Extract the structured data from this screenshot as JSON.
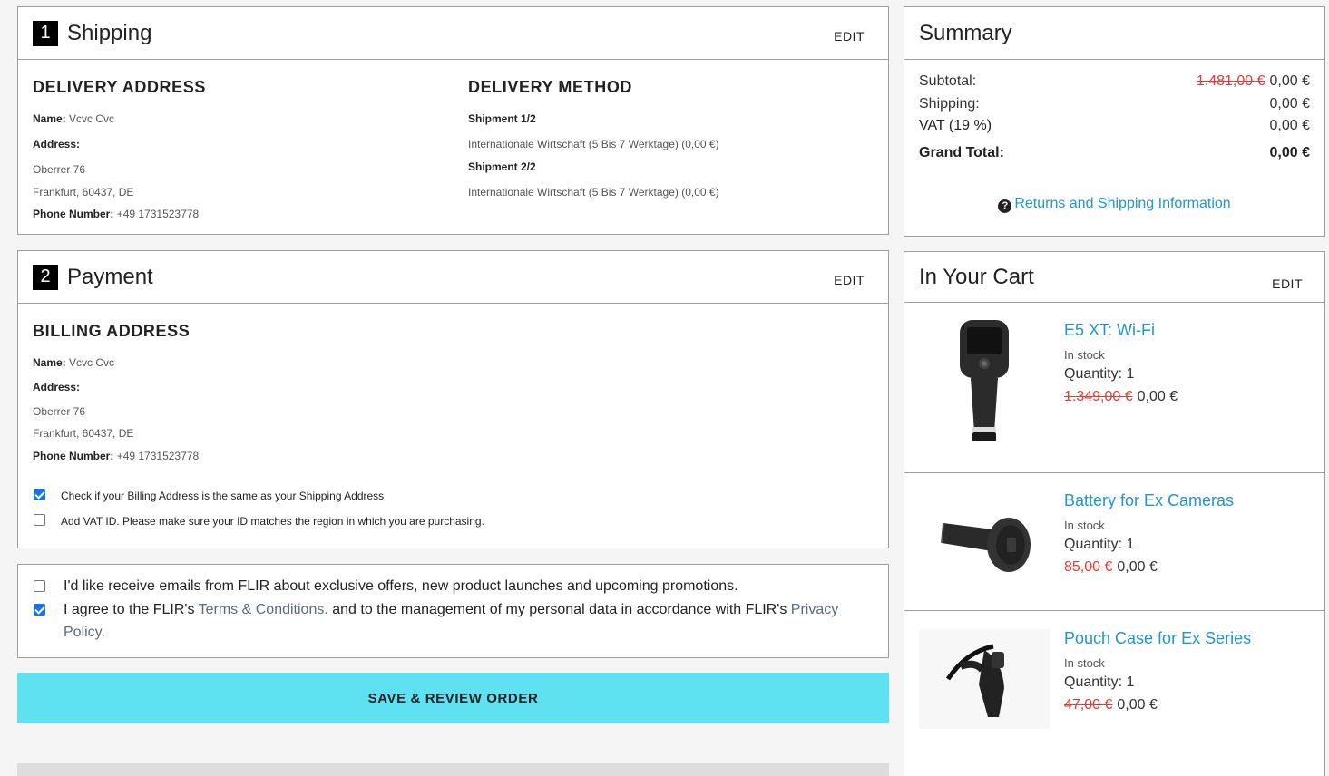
{
  "shipping": {
    "step": "1",
    "title": "Shipping",
    "edit": "EDIT",
    "delivery_address": {
      "heading": "DELIVERY ADDRESS",
      "name_label": "Name:",
      "name": "Vcvc Cvc",
      "address_label": "Address:",
      "street": "Oberrer 76",
      "city": "Frankfurt, 60437, DE",
      "phone_label": "Phone Number:",
      "phone": "+49 1731523778"
    },
    "delivery_method": {
      "heading": "DELIVERY METHOD",
      "shipments": [
        {
          "label": "Shipment 1/2",
          "method": "Internationale Wirtschaft (5 Bis 7 Werktage) (0,00 €)"
        },
        {
          "label": "Shipment 2/2",
          "method": "Internationale Wirtschaft (5 Bis 7 Werktage) (0,00 €)"
        }
      ]
    }
  },
  "payment": {
    "step": "2",
    "title": "Payment",
    "edit": "EDIT",
    "billing": {
      "heading": "BILLING ADDRESS",
      "name_label": "Name:",
      "name": "Vcvc Cvc",
      "address_label": "Address:",
      "street": "Oberrer 76",
      "city": "Frankfurt, 60437, DE",
      "phone_label": "Phone Number:",
      "phone": "+49 1731523778"
    },
    "same_as_shipping": {
      "label": "Check if your Billing Address is the same as your Shipping Address",
      "checked": true
    },
    "vat_id": {
      "label": "Add VAT ID. Please make sure your ID matches the region in which you are purchasing.",
      "checked": false
    }
  },
  "consent": {
    "emails": {
      "label": "I'd like receive emails from FLIR about exclusive offers, new product launches and upcoming promotions.",
      "checked": false
    },
    "terms": {
      "checked": true,
      "prefix": "I agree to the FLIR's ",
      "terms_link": "Terms & Conditions.",
      "middle": " and to the management of my personal data in accordance with FLIR's ",
      "privacy_link": "Privacy Policy."
    }
  },
  "save_button": "SAVE & REVIEW ORDER",
  "summary": {
    "title": "Summary",
    "subtotal_label": "Subtotal:",
    "subtotal_old": "1.481,00 €",
    "subtotal": "0,00 €",
    "shipping_label": "Shipping:",
    "shipping": "0,00 €",
    "vat_label": "VAT (19 %)",
    "vat": "0,00 €",
    "grand_label": "Grand Total:",
    "grand": "0,00 €",
    "returns_link": "Returns and Shipping Information",
    "returns_icon": "?"
  },
  "cart": {
    "title": "In Your Cart",
    "edit": "EDIT",
    "items": [
      {
        "name": "E5 XT: Wi-Fi",
        "stock": "In stock",
        "quantity": "Quantity: 1",
        "old_price": "1.349,00 €",
        "price": "0,00 €",
        "icon": "thermal-camera"
      },
      {
        "name": "Battery for Ex Cameras",
        "stock": "In stock",
        "quantity": "Quantity: 1",
        "old_price": "85,00 €",
        "price": "0,00 €",
        "icon": "battery"
      },
      {
        "name": "Pouch Case for Ex Series",
        "stock": "In stock",
        "quantity": "Quantity: 1",
        "old_price": "47,00 €",
        "price": "0,00 €",
        "icon": "pouch-case"
      }
    ]
  },
  "colors": {
    "accent_button": "#5ee1f0",
    "link": "#2196c8",
    "strike": "#e53935",
    "checkbox": "#1a73e8"
  }
}
